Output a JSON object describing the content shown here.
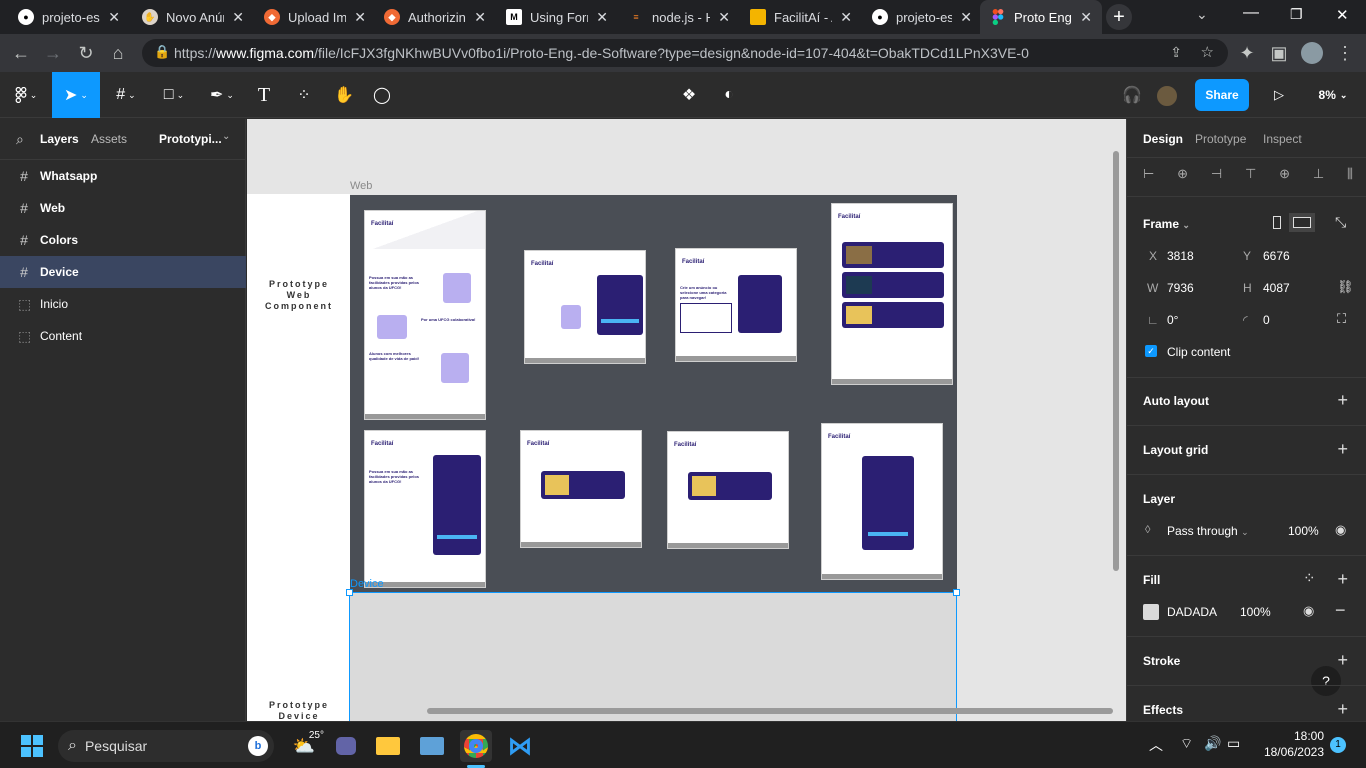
{
  "browser": {
    "tabs": [
      {
        "label": "projeto-es",
        "icon": "github-icon"
      },
      {
        "label": "Novo Anún",
        "icon": "hand-icon"
      },
      {
        "label": "Upload Im",
        "icon": "upload-icon"
      },
      {
        "label": "Authorizin",
        "icon": "authorize-icon"
      },
      {
        "label": "Using Forr",
        "icon": "m-logo-icon"
      },
      {
        "label": "node.js - H",
        "icon": "stack-icon"
      },
      {
        "label": "FacilitAí - A",
        "icon": "slides-icon"
      },
      {
        "label": "projeto-es",
        "icon": "github-icon"
      },
      {
        "label": "Proto Eng.",
        "icon": "figma-icon"
      }
    ],
    "url_prefix": "https://",
    "url_domain": "www.figma.com",
    "url_path": "/file/IcFJX3fgNKhwBUVv0fbo1i/Proto-Eng.-de-Software?type=design&node-id=107-404&t=ObakTDCd1LPnX3VE-0"
  },
  "toolbar": {
    "share_label": "Share",
    "zoom": "8%"
  },
  "left_panel": {
    "tabs": {
      "layers": "Layers",
      "assets": "Assets",
      "page": "Prototypi..."
    },
    "layers": [
      {
        "label": "Whatsapp",
        "type": "frame"
      },
      {
        "label": "Web",
        "type": "frame"
      },
      {
        "label": "Colors",
        "type": "frame"
      },
      {
        "label": "Device",
        "type": "frame"
      },
      {
        "label": "Inicio",
        "type": "section"
      },
      {
        "label": "Content",
        "type": "section"
      }
    ]
  },
  "canvas": {
    "web_label": "Web",
    "proto_web_label": "Prototype\nWeb\nComponent",
    "proto_device_label": "Prototype\nDevice",
    "device_label": "Device",
    "hero_text": "Possua em sua mão as facilidades providas pelos alunos da UFCG!",
    "collab_text": "Por uma UFCG colaborativa!",
    "quality_text": "Alunos com melhores qualidade de vida de paid!",
    "categories_text": "Crie um anúncio ou selecione uma categoria para navegar!"
  },
  "right_panel": {
    "tabs": {
      "design": "Design",
      "prototype": "Prototype",
      "inspect": "Inspect"
    },
    "frame_label": "Frame",
    "x_label": "X",
    "x": "3818",
    "y_label": "Y",
    "y": "6676",
    "w_label": "W",
    "w": "7936",
    "h_label": "H",
    "h": "4087",
    "rotation": "0°",
    "radius": "0",
    "clip_label": "Clip content",
    "auto_layout": "Auto layout",
    "layout_grid": "Layout grid",
    "layer": "Layer",
    "blend": "Pass through",
    "opacity": "100%",
    "fill": "Fill",
    "fill_hex": "DADADA",
    "fill_opacity": "100%",
    "stroke": "Stroke",
    "effects": "Effects",
    "fill_color": "#dadada"
  },
  "taskbar": {
    "search": "Pesquisar",
    "temp": "25°",
    "time": "18:00",
    "date": "18/06/2023",
    "badge": "1"
  }
}
